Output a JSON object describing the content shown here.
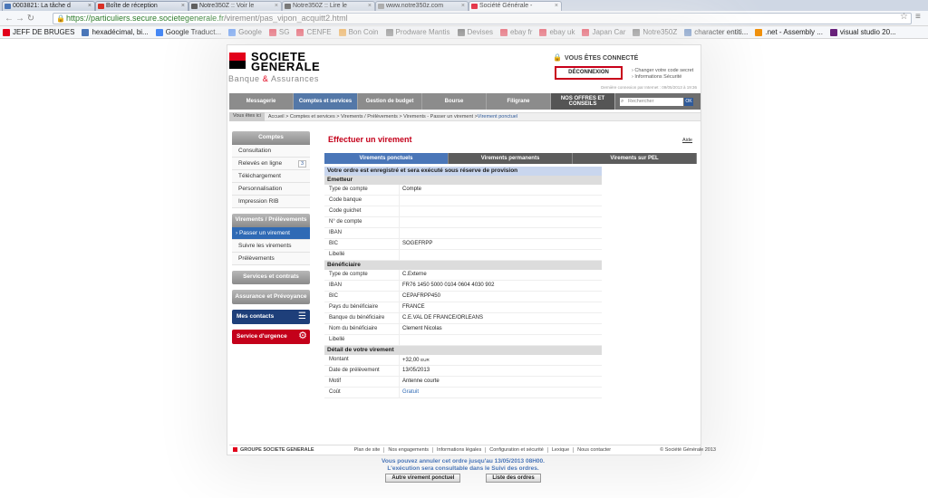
{
  "browser": {
    "tabs": [
      {
        "title": "0003821: La tâche d",
        "active": false,
        "favicon": "#4a76b8"
      },
      {
        "title": "Boîte de réception",
        "active": false,
        "favicon": "#d93025"
      },
      {
        "title": "Notre350Z :: Voir le",
        "active": false,
        "favicon": "#555555"
      },
      {
        "title": "Notre350Z :: Lire le",
        "active": false,
        "favicon": "#555555"
      },
      {
        "title": "www.notre350z.com",
        "active": false,
        "favicon": "#999999"
      },
      {
        "title": "Société Générale -",
        "active": true,
        "favicon": "#e2001a"
      }
    ],
    "url_secure": "https://particuliers.secure.societegenerale.fr",
    "url_path": "/virement/pas_vipon_acquitt2.html",
    "bookmarks": [
      {
        "label": "JEFF DE BRUGES",
        "color": "#e2001a"
      },
      {
        "label": "hexadécimal, bi...",
        "color": "#4a76b8"
      },
      {
        "label": "Google Traduct...",
        "color": "#4285f4"
      },
      {
        "label": "Google",
        "color": "#4285f4"
      },
      {
        "label": "SG",
        "color": "#e2001a"
      },
      {
        "label": "CENFE",
        "color": "#e2001a"
      },
      {
        "label": "Bon Coin",
        "color": "#f08c00"
      },
      {
        "label": "Prodware Mantis",
        "color": "#555555"
      },
      {
        "label": "Devises",
        "color": "#333333"
      },
      {
        "label": "ebay fr",
        "color": "#e2001a"
      },
      {
        "label": "ebay uk",
        "color": "#e2001a"
      },
      {
        "label": "Japan Car",
        "color": "#e2001a"
      },
      {
        "label": "Notre350Z",
        "color": "#555555"
      },
      {
        "label": "character entiti...",
        "color": "#4a76b8"
      },
      {
        "label": ".net - Assembly ...",
        "color": "#f08c00"
      },
      {
        "label": "visual studio 20...",
        "color": "#68217a"
      }
    ]
  },
  "header": {
    "logo_line1": "SOCIETE",
    "logo_line2": "GENERALE",
    "tagline_a": "Banque ",
    "tagline_amp": "&",
    "tagline_b": " Assurances",
    "connected": "VOUS ÊTES CONNECTÉ",
    "logout": "DÉCONNEXION",
    "link_change_code": "Changer votre code secret",
    "link_security": "Informations Sécurité",
    "last_connection": "Dernière connexion par Internet : 09/05/2013 à 19:36"
  },
  "nav": {
    "items": [
      {
        "label": "Messagerie",
        "active": false
      },
      {
        "label": "Comptes et services",
        "active": true
      },
      {
        "label": "Gestion de budget",
        "active": false
      },
      {
        "label": "Bourse",
        "active": false
      },
      {
        "label": "Filigrane",
        "active": false
      },
      {
        "label": "NOS OFFRES ET CONSEILS",
        "active": false
      }
    ],
    "search_placeholder": "Rechercher",
    "search_ok": "OK"
  },
  "breadcrumb": {
    "here": "Vous êtes ici",
    "path": "Accueil > Comptes et services > Virements / Prélèvements > Virements - Passer un virement > ",
    "current": "Virement ponctuel"
  },
  "sidebar": {
    "comptes_header": "Comptes",
    "comptes_items": [
      {
        "label": "Consultation",
        "badge": ""
      },
      {
        "label": "Relevés en ligne",
        "badge": "3"
      },
      {
        "label": "Téléchargement",
        "badge": ""
      },
      {
        "label": "Personnalisation",
        "badge": ""
      },
      {
        "label": "Impression RIB",
        "badge": ""
      }
    ],
    "virements_header": "Virements / Prélèvements",
    "virements_items": [
      {
        "label": "› Passer un virement",
        "active": true
      },
      {
        "label": "Suivre les virements",
        "active": false
      },
      {
        "label": "Prélèvements",
        "active": false
      }
    ],
    "services_header": "Services et contrats",
    "assurance_header": "Assurance et Prévoyance",
    "contacts": "Mes contacts",
    "urgence": "Service d'urgence"
  },
  "main": {
    "title": "Effectuer un virement",
    "aide": "Aide",
    "tabs": [
      {
        "label": "Virements ponctuels",
        "active": true
      },
      {
        "label": "Virements permanents",
        "active": false
      },
      {
        "label": "Virements sur PEL",
        "active": false
      }
    ],
    "message": "Votre ordre est enregistré et sera exécuté sous réserve de provision",
    "emetteur_title": "Emetteur",
    "emetteur": [
      {
        "k": "Type de compte",
        "v": "Compte"
      },
      {
        "k": "Code banque",
        "v": ""
      },
      {
        "k": "Code guichet",
        "v": ""
      },
      {
        "k": "N° de compte",
        "v": ""
      },
      {
        "k": "IBAN",
        "v": ""
      },
      {
        "k": "BIC",
        "v": "SOGEFRPP"
      },
      {
        "k": "Libellé",
        "v": ""
      }
    ],
    "beneficiaire_title": "Bénéficiaire",
    "beneficiaire": [
      {
        "k": "Type de compte",
        "v": "C.Externe"
      },
      {
        "k": "IBAN",
        "v": "FR76 1450 5000 0104 0604 4030 902"
      },
      {
        "k": "BIC",
        "v": "CEPAFRPP450"
      },
      {
        "k": "Pays du bénéficiaire",
        "v": "FRANCE"
      },
      {
        "k": "Banque du bénéficiaire",
        "v": "C.E.VAL DE FRANCE/ORLEANS"
      },
      {
        "k": "Nom du bénéficiaire",
        "v": "Clement Nicolas"
      },
      {
        "k": "Libellé",
        "v": ""
      }
    ],
    "detail_title": "Détail de votre virement",
    "montant_label": "Montant",
    "montant_value": "+32,00",
    "montant_unit": "EUR",
    "detail": [
      {
        "k": "Date de prélèvement",
        "v": "13/05/2013"
      },
      {
        "k": "Motif",
        "v": "Antenne courte"
      }
    ],
    "cout_label": "Coût",
    "cout_value": "Gratuit",
    "notice_line1": "Vous pouvez annuler cet ordre jusqu'au 13/05/2013 08H00.",
    "notice_line2": "L'exécution sera consultable dans le Suivi des ordres.",
    "btn_autre": "Autre virement ponctuel",
    "btn_liste": "Liste des ordres"
  },
  "footer": {
    "group": "GROUPE SOCIETE GENERALE",
    "links": [
      "Plan de site",
      "Nos engagements",
      "Informations légales",
      "Configuration et sécurité",
      "Lexique",
      "Nous contacter"
    ],
    "copyright": "© Société Générale 2013"
  }
}
